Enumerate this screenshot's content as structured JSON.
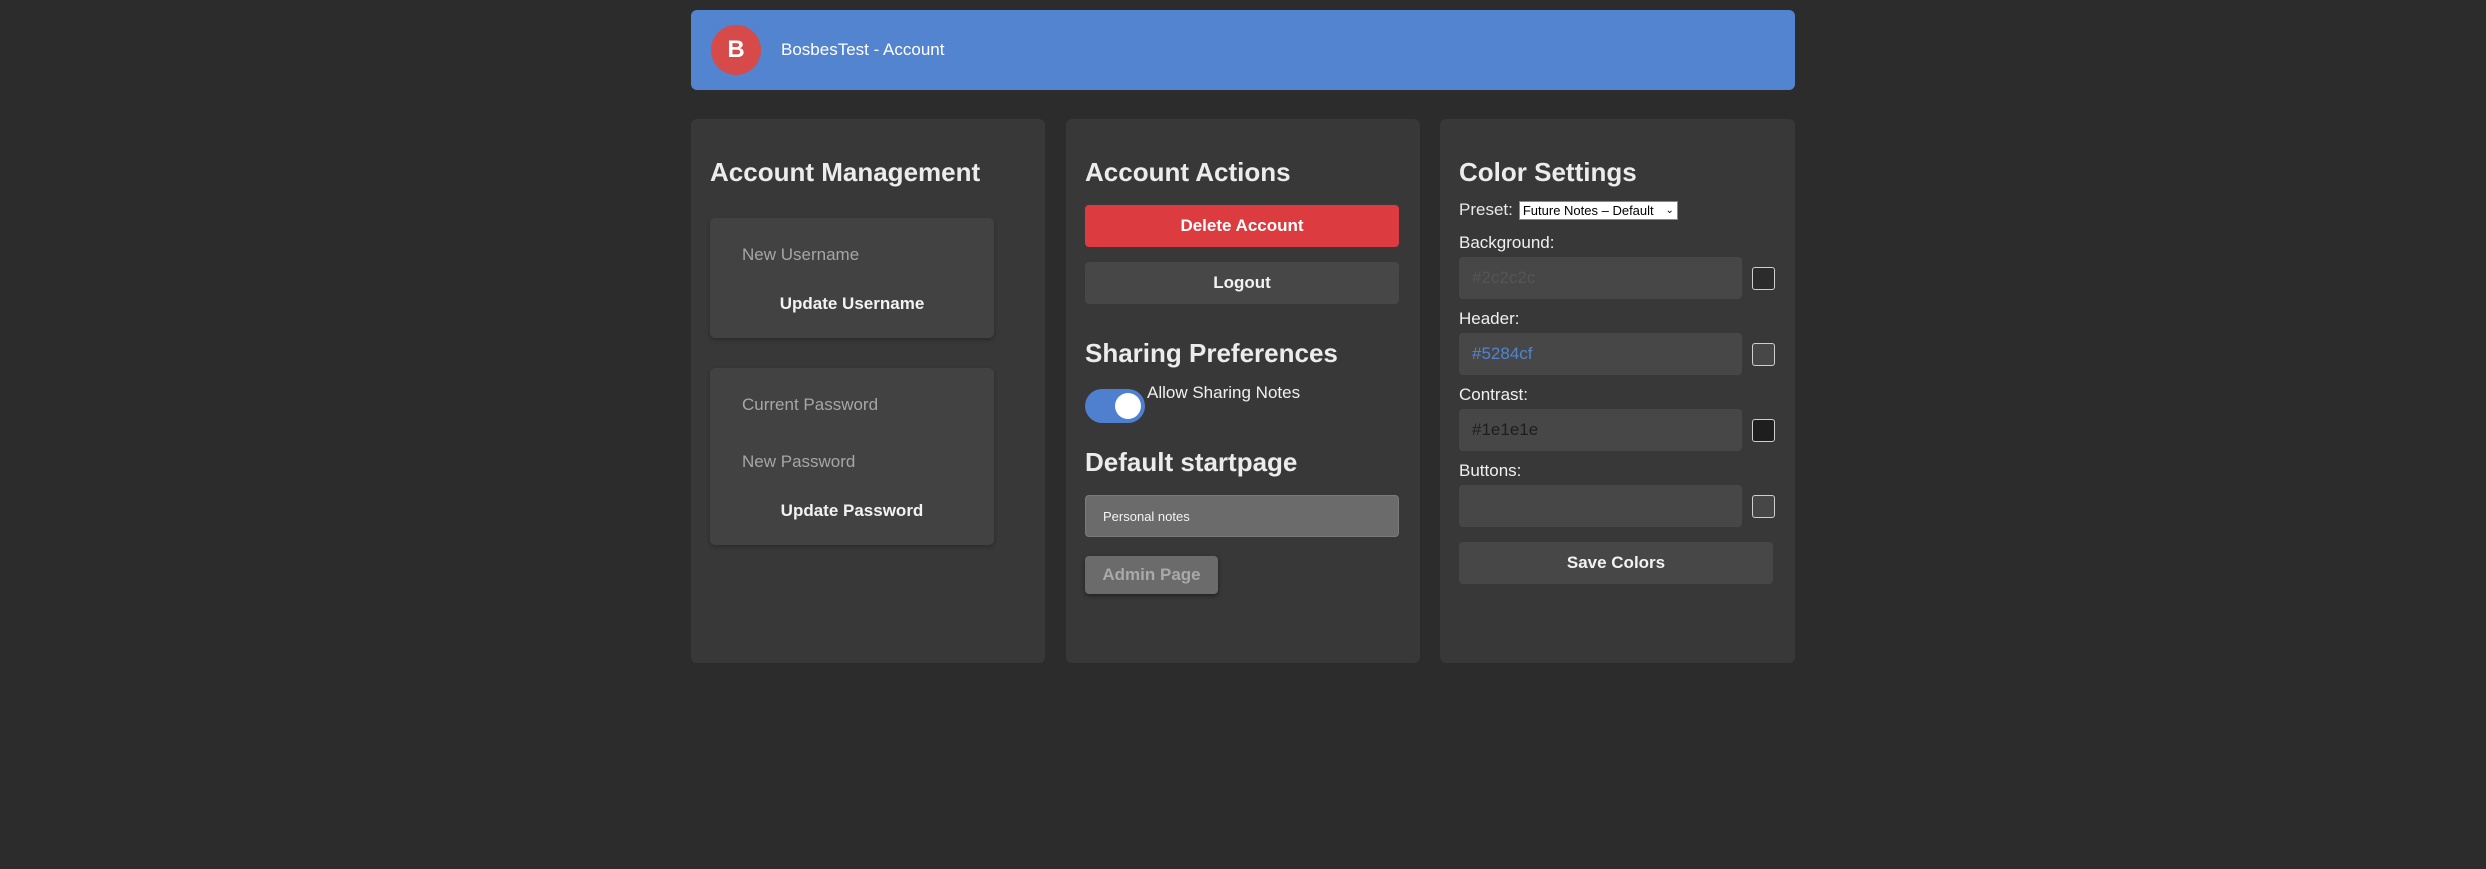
{
  "header": {
    "avatar_letter": "B",
    "title": "BosbesTest - Account"
  },
  "account_management": {
    "heading": "Account Management",
    "username_panel": {
      "new_username_placeholder": "New Username",
      "update_button": "Update Username"
    },
    "password_panel": {
      "current_password_placeholder": "Current Password",
      "new_password_placeholder": "New Password",
      "update_button": "Update Password"
    }
  },
  "account_actions": {
    "heading": "Account Actions",
    "delete_button": "Delete Account",
    "logout_button": "Logout",
    "sharing_heading": "Sharing Preferences",
    "allow_sharing_label": "Allow Sharing Notes",
    "allow_sharing_enabled": true,
    "startpage_heading": "Default startpage",
    "startpage_selected": "Personal notes",
    "admin_button": "Admin Page"
  },
  "color_settings": {
    "heading": "Color Settings",
    "preset_label": "Preset:",
    "preset_selected": "Future Notes – Default",
    "fields": [
      {
        "label": "Background:",
        "value": "#2c2c2c",
        "text_color": "#555555",
        "swatch": "#2c2c2c"
      },
      {
        "label": "Header:",
        "value": "#5284cf",
        "text_color": "#5284cf",
        "swatch": "#474747"
      },
      {
        "label": "Contrast:",
        "value": "#1e1e1e",
        "text_color": "#1e1e1e",
        "swatch": "#1e1e1e"
      },
      {
        "label": "Buttons:",
        "value": "",
        "text_color": "#474747",
        "swatch": "#474747"
      }
    ],
    "save_button": "Save Colors"
  },
  "colors": {
    "background": "#2c2c2c",
    "header": "#5284cf",
    "avatar": "#d64a4a",
    "card": "#383838",
    "danger": "#dc3b3f",
    "toggle_on": "#4f7fcf"
  }
}
